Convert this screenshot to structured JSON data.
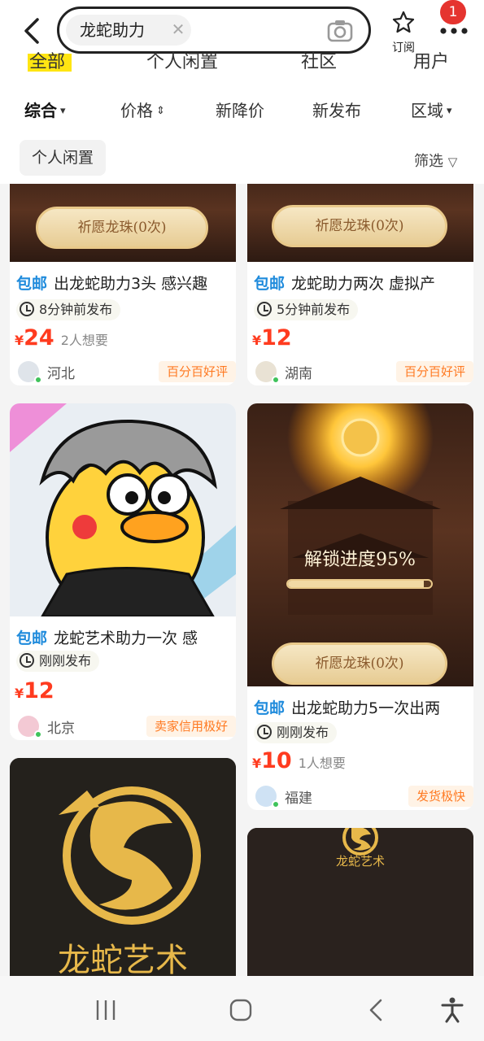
{
  "header": {
    "search_query": "龙蛇助力",
    "clear_icon": "close-icon",
    "camera_icon": "camera-icon",
    "subscribe_label": "订阅",
    "notification_count": "1",
    "category_tabs": [
      "全部",
      "个人闲置",
      "社区",
      "用户"
    ]
  },
  "filters": {
    "items": [
      {
        "label": "综合",
        "arrow": "⌄",
        "active": true
      },
      {
        "label": "价格",
        "arrow": "⌃⌄",
        "active": false
      },
      {
        "label": "新降价",
        "arrow": "",
        "active": false
      },
      {
        "label": "新发布",
        "arrow": "",
        "active": false
      },
      {
        "label": "区域",
        "arrow": "⌄",
        "active": false
      }
    ],
    "tag_chip": "个人闲置",
    "filter_button": "筛选"
  },
  "listings": [
    {
      "free_shipping": "包邮",
      "title": "出龙蛇助力3头 感兴趣",
      "posted": "8分钟前发布",
      "currency": "¥",
      "price": "24",
      "wants": "2人想要",
      "region": "河北",
      "seller_tag": "百分百好评",
      "image_button": "祈愿龙珠(0次)"
    },
    {
      "free_shipping": "包邮",
      "title": "龙蛇助力两次 虚拟产",
      "posted": "5分钟前发布",
      "currency": "¥",
      "price": "12",
      "wants": "",
      "region": "湖南",
      "seller_tag": "百分百好评",
      "image_button": "祈愿龙珠(0次)"
    },
    {
      "free_shipping": "包邮",
      "title": "龙蛇艺术助力一次 感",
      "posted": "刚刚发布",
      "currency": "¥",
      "price": "12",
      "wants": "",
      "region": "北京",
      "seller_tag": "卖家信用极好"
    },
    {
      "free_shipping": "包邮",
      "title": "出龙蛇助力5一次出两",
      "posted": "刚刚发布",
      "currency": "¥",
      "price": "10",
      "wants": "1人想要",
      "region": "福建",
      "seller_tag": "发货极快",
      "image_progress_text": "解锁进度95%",
      "image_button": "祈愿龙珠(0次)",
      "progress": 0.95
    },
    {
      "image_text": "龙蛇艺术"
    },
    {
      "image_text": "龙蛇艺术"
    }
  ],
  "bottom_nav": [
    "recent-apps-icon",
    "home-icon",
    "back-icon",
    "accessibility-icon"
  ],
  "colors": {
    "accent_yellow": "#ffe512",
    "price_red": "#ff3b1f",
    "free_ship_blue": "#1f8bdc",
    "badge_red": "#e5342f",
    "seller_tag_orange": "#ff7a22",
    "gold": "#e7b84a"
  }
}
